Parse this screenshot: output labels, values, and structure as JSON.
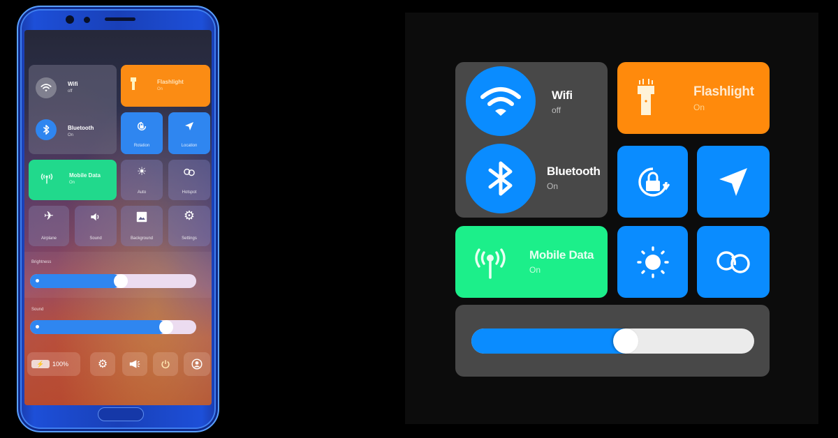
{
  "phone": {
    "tiles": {
      "wifi": {
        "label": "Wifi",
        "status": "off"
      },
      "bluetooth": {
        "label": "Bluetooth",
        "status": "On"
      },
      "flashlight": {
        "label": "Flashlight",
        "status": "On"
      },
      "rotation": {
        "label": "Rotation"
      },
      "location": {
        "label": "Location"
      },
      "mobile_data": {
        "label": "Mobile Data",
        "status": "On"
      },
      "auto": {
        "label": "Auto"
      },
      "hotspot": {
        "label": "Hotspot"
      },
      "airplane": {
        "label": "Airplane"
      },
      "sound": {
        "label": "Sound"
      },
      "background": {
        "label": "Background"
      },
      "settings": {
        "label": "Settings"
      }
    },
    "brightness": {
      "label": "Brightness",
      "value_percent": 55
    },
    "sound_slider": {
      "label": "Sound",
      "value_percent": 85
    },
    "bottom_bar": {
      "battery": {
        "text": "100%",
        "icon": "battery-charging-icon"
      },
      "buttons": [
        "gear-icon",
        "megaphone-icon",
        "power-icon",
        "user-icon"
      ]
    }
  },
  "panel": {
    "tiles": {
      "wifi": {
        "label": "Wifi",
        "status": "off",
        "icon": "wifi-icon"
      },
      "bluetooth": {
        "label": "Bluetooth",
        "status": "On",
        "icon": "bluetooth-icon"
      },
      "flashlight": {
        "label": "Flashlight",
        "status": "On",
        "icon": "flashlight-icon"
      },
      "rotation": {
        "icon": "rotation-lock-icon"
      },
      "location": {
        "icon": "location-arrow-icon"
      },
      "mobile_data": {
        "label": "Mobile Data",
        "status": "On",
        "icon": "antenna-icon"
      },
      "brightness": {
        "icon": "sun-icon"
      },
      "hotspot": {
        "icon": "link-icon"
      }
    },
    "slider": {
      "value_percent": 55
    }
  },
  "colors": {
    "blue": "#0a8cff",
    "orange": "#ff8a0c",
    "green": "#1cef8a",
    "tile_gray": "#484848",
    "panel_bg": "#0c0c0c",
    "phone_body": "#1d4fd8"
  }
}
